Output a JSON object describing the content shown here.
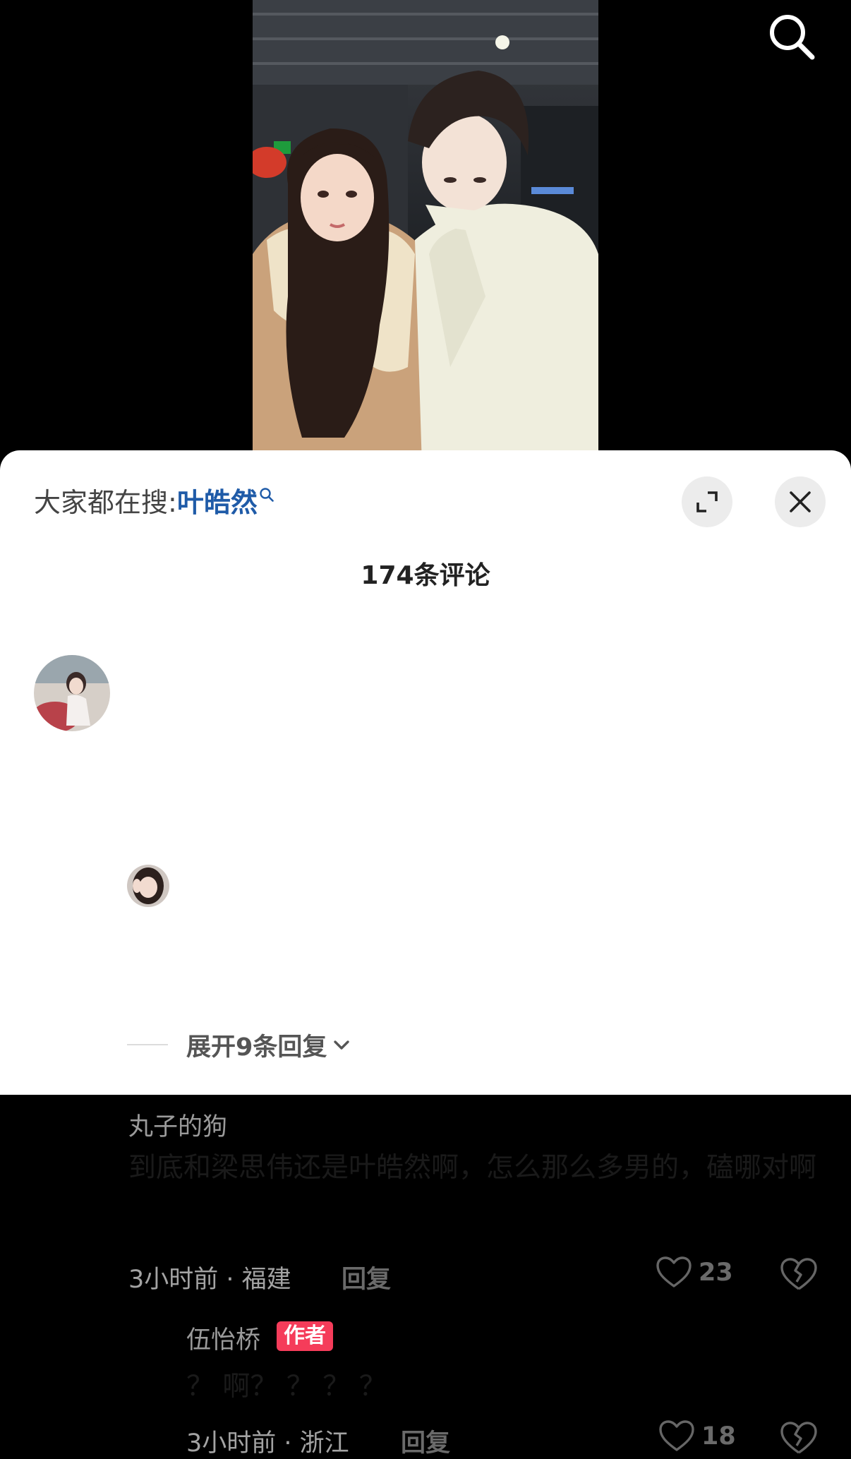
{
  "header": {
    "search_icon": "search-icon"
  },
  "trending": {
    "prefix": "大家都在搜:",
    "term": "叶皓然"
  },
  "comment_count_title": "174条评论",
  "comments": [
    {
      "username": "丸子的狗",
      "text": "到底和梁思伟还是叶皓然啊，怎么那么多男的，磕哪对啊",
      "meta": "3小时前 · 福建",
      "reply_label": "回复",
      "likes": "23"
    }
  ],
  "replies": [
    {
      "username": "伍怡桥",
      "badge": "作者",
      "text": "？ 啊？ ？ ？ ？",
      "meta": "3小时前 · 浙江",
      "reply_label": "回复",
      "likes": "18"
    }
  ],
  "expand_replies": "展开9条回复",
  "colors": {
    "accent_link": "#1f5ba8",
    "author_badge": "#f53c5a"
  }
}
